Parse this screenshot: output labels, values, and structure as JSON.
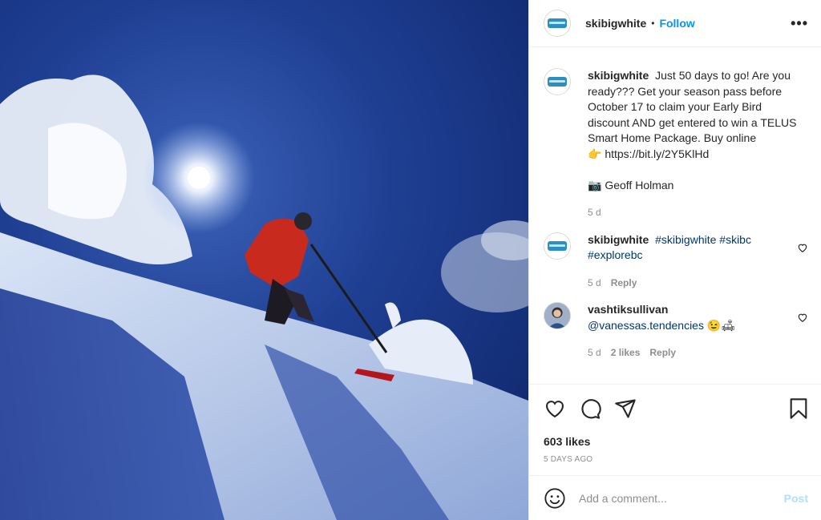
{
  "header": {
    "username": "skibigwhite",
    "separator": "•",
    "follow_label": "Follow",
    "more_label": "•••"
  },
  "caption": {
    "username": "skibigwhite",
    "text": "Just 50 days to go! Are you ready??? Get your season pass before October 17 to claim your Early Bird discount AND get entered to win a TELUS Smart Home Package. Buy online",
    "link_emoji": "👉",
    "link": "https://bit.ly/2Y5KlHd",
    "credit_emoji": "📷",
    "credit": "Geoff Holman",
    "time": "5 d"
  },
  "comments": [
    {
      "username": "skibigwhite",
      "tags": [
        "#skibigwhite",
        "#skibc",
        "#explorebc"
      ],
      "time": "5 d",
      "reply_label": "Reply"
    },
    {
      "username": "vashtiksullivan",
      "mention": "@vanessas.tendencies",
      "emojis": "😉🛋",
      "time": "5 d",
      "likes_label": "2 likes",
      "reply_label": "Reply"
    }
  ],
  "likes": "603 likes",
  "date": "5 DAYS AGO",
  "comment_input": {
    "placeholder": "Add a comment...",
    "post_label": "Post"
  },
  "colors": {
    "link_blue": "#0095f6",
    "tag_blue": "#00376b",
    "muted_gray": "#8e8e8e",
    "disabled_post": "#b2dffc"
  }
}
